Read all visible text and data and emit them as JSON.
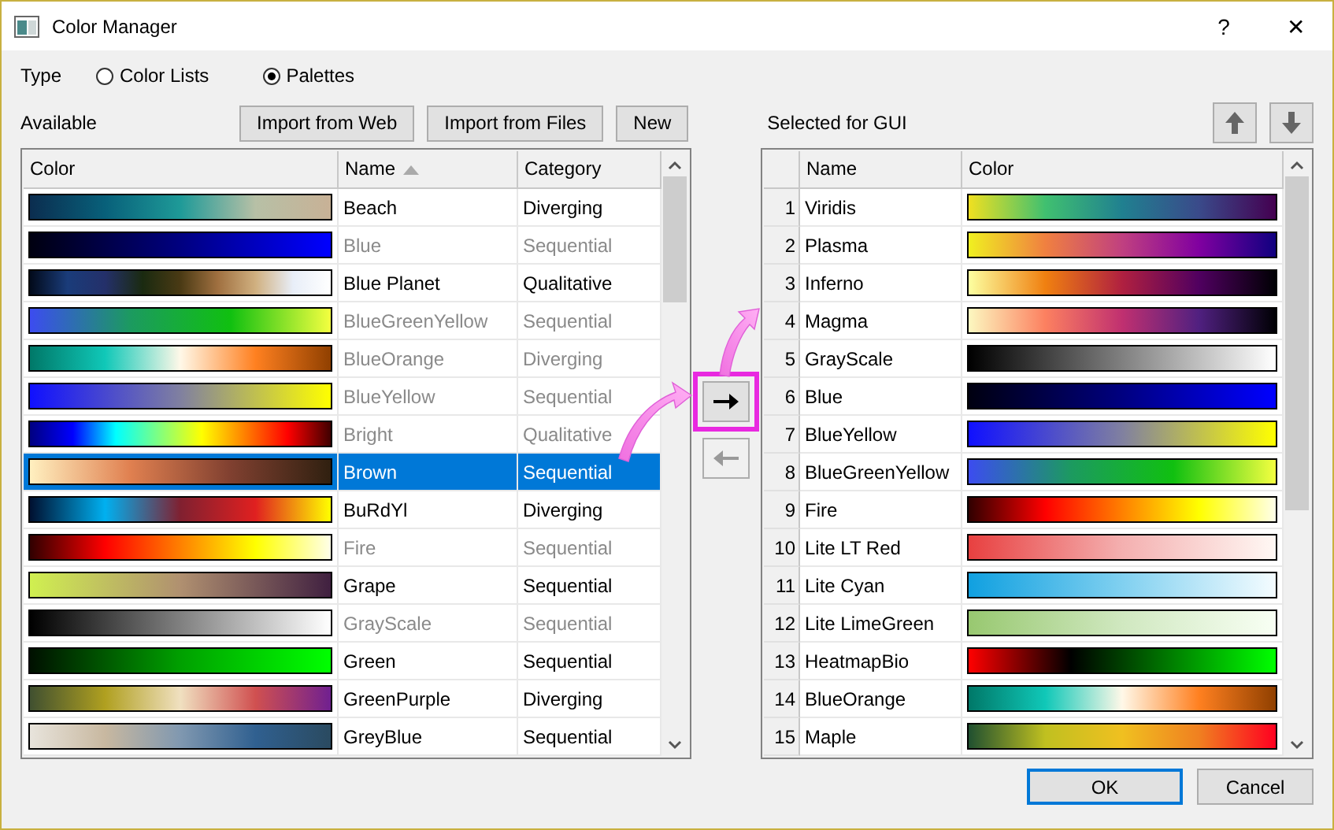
{
  "window": {
    "title": "Color Manager",
    "help": "?",
    "close": "✕"
  },
  "type": {
    "label": "Type",
    "options": [
      {
        "label": "Color Lists",
        "selected": false
      },
      {
        "label": "Palettes",
        "selected": true
      }
    ]
  },
  "available": {
    "label": "Available",
    "buttons": [
      "Import from Web",
      "Import from Files",
      "New"
    ],
    "columns": [
      "Color",
      "Name",
      "Category"
    ],
    "rows": [
      {
        "name": "Beach",
        "category": "Diverging",
        "disabled": false,
        "selected": false
      },
      {
        "name": "Blue",
        "category": "Sequential",
        "disabled": true,
        "selected": false
      },
      {
        "name": "Blue Planet",
        "category": "Qualitative",
        "disabled": false,
        "selected": false
      },
      {
        "name": "BlueGreenYellow",
        "category": "Sequential",
        "disabled": true,
        "selected": false
      },
      {
        "name": "BlueOrange",
        "category": "Diverging",
        "disabled": true,
        "selected": false
      },
      {
        "name": "BlueYellow",
        "category": "Sequential",
        "disabled": true,
        "selected": false
      },
      {
        "name": "Bright",
        "category": "Qualitative",
        "disabled": true,
        "selected": false
      },
      {
        "name": "Brown",
        "category": "Sequential",
        "disabled": false,
        "selected": true
      },
      {
        "name": "BuRdYl",
        "category": "Diverging",
        "disabled": false,
        "selected": false
      },
      {
        "name": "Fire",
        "category": "Sequential",
        "disabled": true,
        "selected": false
      },
      {
        "name": "Grape",
        "category": "Sequential",
        "disabled": false,
        "selected": false
      },
      {
        "name": "GrayScale",
        "category": "Sequential",
        "disabled": true,
        "selected": false
      },
      {
        "name": "Green",
        "category": "Sequential",
        "disabled": false,
        "selected": false
      },
      {
        "name": "GreenPurple",
        "category": "Diverging",
        "disabled": false,
        "selected": false
      },
      {
        "name": "GreyBlue",
        "category": "Sequential",
        "disabled": false,
        "selected": false
      }
    ]
  },
  "selected_for_gui": {
    "label": "Selected for GUI",
    "columns": [
      "Name",
      "Color"
    ],
    "rows": [
      {
        "number": "1",
        "name": "Viridis"
      },
      {
        "number": "2",
        "name": "Plasma"
      },
      {
        "number": "3",
        "name": "Inferno"
      },
      {
        "number": "4",
        "name": "Magma"
      },
      {
        "number": "5",
        "name": "GrayScale"
      },
      {
        "number": "6",
        "name": "Blue"
      },
      {
        "number": "7",
        "name": "BlueYellow"
      },
      {
        "number": "8",
        "name": "BlueGreenYellow"
      },
      {
        "number": "9",
        "name": "Fire"
      },
      {
        "number": "10",
        "name": "Lite LT Red"
      },
      {
        "number": "11",
        "name": "Lite Cyan"
      },
      {
        "number": "12",
        "name": "Lite LimeGreen"
      },
      {
        "number": "13",
        "name": "HeatmapBio"
      },
      {
        "number": "14",
        "name": "BlueOrange"
      },
      {
        "number": "15",
        "name": "Maple"
      }
    ]
  },
  "footer": {
    "buttons": [
      "OK",
      "Cancel"
    ]
  }
}
